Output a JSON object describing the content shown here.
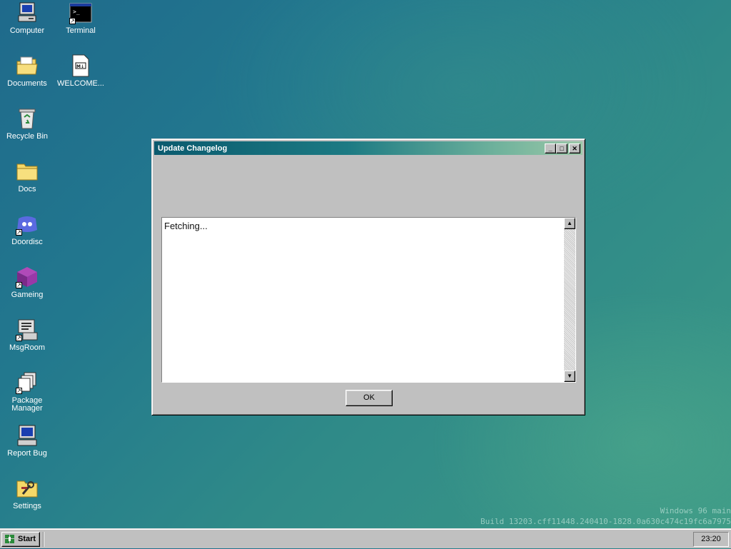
{
  "desktop": {
    "icons": [
      {
        "label": "Computer",
        "icon": "computer-icon"
      },
      {
        "label": "Terminal",
        "icon": "terminal-icon"
      },
      {
        "label": "Documents",
        "icon": "documents-folder-icon"
      },
      {
        "label": "WELCOME...",
        "icon": "markdown-file-icon",
        "badge": "M↓"
      },
      {
        "label": "Recycle Bin",
        "icon": "recycle-bin-icon"
      },
      {
        "label": "Docs",
        "icon": "folder-icon"
      },
      {
        "label": "Doordisc",
        "icon": "doordisc-icon"
      },
      {
        "label": "Gameing",
        "icon": "game-cube-icon"
      },
      {
        "label": "MsgRoom",
        "icon": "msgroom-icon"
      },
      {
        "label": "Package Manager",
        "icon": "package-manager-icon"
      },
      {
        "label": "Report Bug",
        "icon": "report-bug-icon"
      },
      {
        "label": "Settings",
        "icon": "settings-icon"
      }
    ]
  },
  "window": {
    "title": "Update Changelog",
    "minimize_glyph": "_",
    "maximize_glyph": "□",
    "close_glyph": "✕",
    "content_text": "Fetching...",
    "ok_label": "OK"
  },
  "watermark": {
    "line1": "Windows 96 main",
    "line2": "Build 13203.cff11448.240410-1828.0a630c474c19fc6a7975"
  },
  "taskbar": {
    "start_label": "Start",
    "clock": "23:20"
  },
  "colors": {
    "titlebar_start": "#0a5a6e",
    "titlebar_end": "#9cc8a8",
    "desktop": "#22788e",
    "chrome": "#c0c0c0"
  }
}
